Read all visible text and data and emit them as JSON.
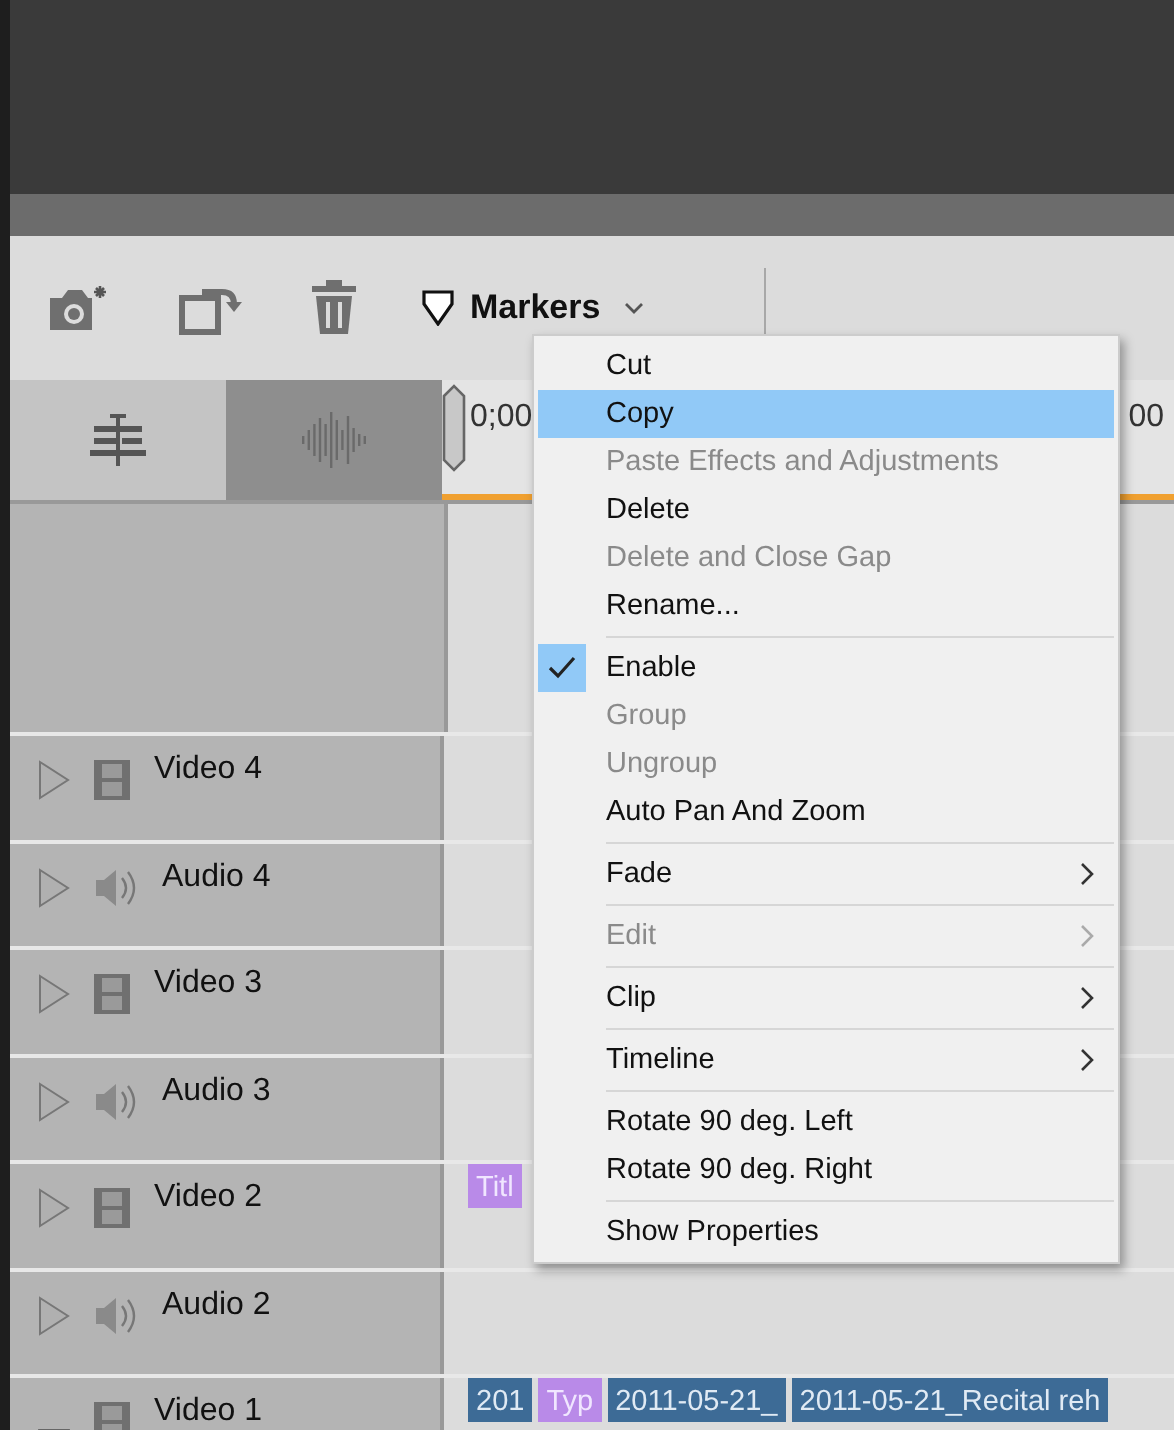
{
  "toolbar": {
    "markers_label": "Markers"
  },
  "view_buttons": [
    {
      "kind": "tracks",
      "selected": false
    },
    {
      "kind": "audio",
      "selected": true
    }
  ],
  "ruler": {
    "start": "0;00",
    "end": "00"
  },
  "tracks": [
    {
      "name": "Video 4",
      "kind": "video",
      "expanded": false
    },
    {
      "name": "Audio 4",
      "kind": "audio",
      "expanded": false
    },
    {
      "name": "Video 3",
      "kind": "video",
      "expanded": false
    },
    {
      "name": "Audio 3",
      "kind": "audio",
      "expanded": false
    },
    {
      "name": "Video 2",
      "kind": "video",
      "expanded": false,
      "clips": [
        {
          "label": "Titl",
          "kind": "title"
        }
      ]
    },
    {
      "name": "Audio 2",
      "kind": "audio",
      "expanded": false
    },
    {
      "name": "Video 1",
      "kind": "video",
      "expanded": true,
      "clips": [
        {
          "label": "201",
          "kind": "video"
        },
        {
          "label": "Typ",
          "kind": "title"
        },
        {
          "label": "2011-05-21_",
          "kind": "video"
        },
        {
          "label": "2011-05-21_Recital reh",
          "kind": "video"
        }
      ]
    }
  ],
  "context_menu": [
    {
      "kind": "item",
      "label": "Cut",
      "selected": false,
      "disabled": false,
      "checked": false,
      "submenu": false
    },
    {
      "kind": "item",
      "label": "Copy",
      "selected": true,
      "disabled": false,
      "checked": false,
      "submenu": false
    },
    {
      "kind": "item",
      "label": "Paste Effects and Adjustments",
      "selected": false,
      "disabled": true,
      "checked": false,
      "submenu": false
    },
    {
      "kind": "item",
      "label": "Delete",
      "selected": false,
      "disabled": false,
      "checked": false,
      "submenu": false
    },
    {
      "kind": "item",
      "label": "Delete and Close Gap",
      "selected": false,
      "disabled": true,
      "checked": false,
      "submenu": false
    },
    {
      "kind": "item",
      "label": "Rename...",
      "selected": false,
      "disabled": false,
      "checked": false,
      "submenu": false
    },
    {
      "kind": "separator"
    },
    {
      "kind": "item",
      "label": "Enable",
      "selected": false,
      "disabled": false,
      "checked": true,
      "submenu": false
    },
    {
      "kind": "item",
      "label": "Group",
      "selected": false,
      "disabled": true,
      "checked": false,
      "submenu": false
    },
    {
      "kind": "item",
      "label": "Ungroup",
      "selected": false,
      "disabled": true,
      "checked": false,
      "submenu": false
    },
    {
      "kind": "item",
      "label": "Auto Pan And Zoom",
      "selected": false,
      "disabled": false,
      "checked": false,
      "submenu": false
    },
    {
      "kind": "separator"
    },
    {
      "kind": "item",
      "label": "Fade",
      "selected": false,
      "disabled": false,
      "checked": false,
      "submenu": true
    },
    {
      "kind": "separator"
    },
    {
      "kind": "item",
      "label": "Edit",
      "selected": false,
      "disabled": true,
      "checked": false,
      "submenu": true
    },
    {
      "kind": "separator"
    },
    {
      "kind": "item",
      "label": "Clip",
      "selected": false,
      "disabled": false,
      "checked": false,
      "submenu": true
    },
    {
      "kind": "separator"
    },
    {
      "kind": "item",
      "label": "Timeline",
      "selected": false,
      "disabled": false,
      "checked": false,
      "submenu": true
    },
    {
      "kind": "separator"
    },
    {
      "kind": "item",
      "label": "Rotate 90 deg. Left",
      "selected": false,
      "disabled": false,
      "checked": false,
      "submenu": false
    },
    {
      "kind": "item",
      "label": "Rotate 90 deg. Right",
      "selected": false,
      "disabled": false,
      "checked": false,
      "submenu": false
    },
    {
      "kind": "separator"
    },
    {
      "kind": "item",
      "label": "Show Properties",
      "selected": false,
      "disabled": false,
      "checked": false,
      "submenu": false
    }
  ]
}
